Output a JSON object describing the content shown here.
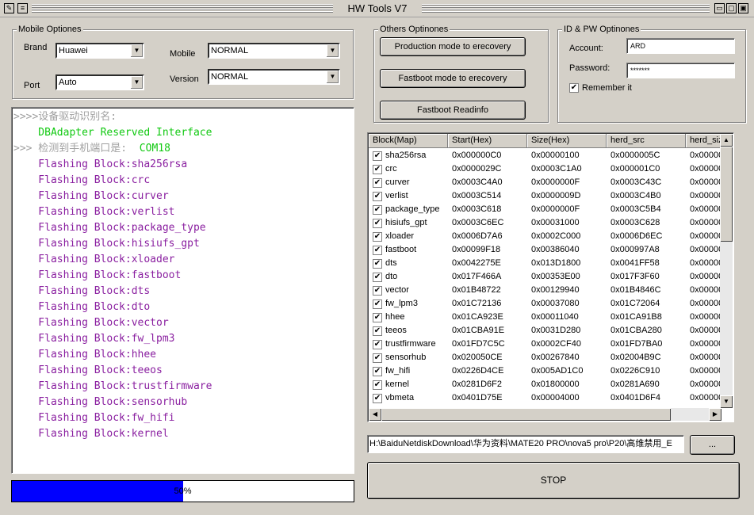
{
  "window": {
    "title": "HW Tools V7",
    "sys_icon": "app-icon",
    "buttons": [
      "minimize",
      "maximize",
      "close"
    ]
  },
  "mobile_options": {
    "label": "Mobile Optiones",
    "brand_label": "Brand",
    "brand_value": "Huawei",
    "port_label": "Port",
    "port_value": "Auto",
    "mobile_label": "Mobile",
    "mobile_value": "NORMAL",
    "version_label": "Version",
    "version_value": "NORMAL"
  },
  "other_options": {
    "label": "Others Optinones",
    "btn1": "Production mode to erecovery",
    "btn2": "Fastboot mode to erecovery",
    "btn3": "Fastboot Readinfo"
  },
  "id_pw": {
    "label": "ID & PW Optinones",
    "account_label": "Account:",
    "account_value": "ARD",
    "password_label": "Password:",
    "password_value": "*******",
    "remember_label": "Remember it",
    "remember_checked": true
  },
  "log_lines": [
    {
      "text": ">>>>设备驱动识别名:",
      "color": "gray"
    },
    {
      "text": "    DBAdapter Reserved Interface",
      "color": "green"
    },
    {
      "text": ">>> 检测到手机端口是:  COM18",
      "color": "gray",
      "suffix": "COM18"
    },
    {
      "text": "    Flashing Block:sha256rsa",
      "color": "purple"
    },
    {
      "text": "    Flashing Block:crc",
      "color": "purple"
    },
    {
      "text": "    Flashing Block:curver",
      "color": "purple"
    },
    {
      "text": "    Flashing Block:verlist",
      "color": "purple"
    },
    {
      "text": "    Flashing Block:package_type",
      "color": "purple"
    },
    {
      "text": "    Flashing Block:hisiufs_gpt",
      "color": "purple"
    },
    {
      "text": "    Flashing Block:xloader",
      "color": "purple"
    },
    {
      "text": "    Flashing Block:fastboot",
      "color": "purple"
    },
    {
      "text": "    Flashing Block:dts",
      "color": "purple"
    },
    {
      "text": "    Flashing Block:dto",
      "color": "purple"
    },
    {
      "text": "    Flashing Block:vector",
      "color": "purple"
    },
    {
      "text": "    Flashing Block:fw_lpm3",
      "color": "purple"
    },
    {
      "text": "    Flashing Block:hhee",
      "color": "purple"
    },
    {
      "text": "    Flashing Block:teeos",
      "color": "purple"
    },
    {
      "text": "    Flashing Block:trustfirmware",
      "color": "purple"
    },
    {
      "text": "    Flashing Block:sensorhub",
      "color": "purple"
    },
    {
      "text": "    Flashing Block:fw_hifi",
      "color": "purple"
    },
    {
      "text": "    Flashing Block:kernel",
      "color": "purple"
    }
  ],
  "progress": {
    "percent": 50,
    "label": "50%",
    "color": "#0000ff"
  },
  "table": {
    "headers": [
      "Block(Map)",
      "Start(Hex)",
      "Size(Hex)",
      "herd_src",
      "herd_size"
    ],
    "rows": [
      [
        "sha256rsa",
        "0x000000C0",
        "0x00000100",
        "0x0000005C",
        "0x00000"
      ],
      [
        "crc",
        "0x0000029C",
        "0x0003C1A0",
        "0x000001C0",
        "0x00000"
      ],
      [
        "curver",
        "0x0003C4A0",
        "0x0000000F",
        "0x0003C43C",
        "0x00000"
      ],
      [
        "verlist",
        "0x0003C514",
        "0x0000009D",
        "0x0003C4B0",
        "0x00000"
      ],
      [
        "package_type",
        "0x0003C618",
        "0x0000000F",
        "0x0003C5B4",
        "0x00000"
      ],
      [
        "hisiufs_gpt",
        "0x0003C6EC",
        "0x00031000",
        "0x0003C628",
        "0x00000"
      ],
      [
        "xloader",
        "0x0006D7A6",
        "0x0002C000",
        "0x0006D6EC",
        "0x00000"
      ],
      [
        "fastboot",
        "0x00099F18",
        "0x00386040",
        "0x000997A8",
        "0x00000"
      ],
      [
        "dts",
        "0x0042275E",
        "0x013D1800",
        "0x0041FF58",
        "0x00000"
      ],
      [
        "dto",
        "0x017F466A",
        "0x00353E00",
        "0x017F3F60",
        "0x00000"
      ],
      [
        "vector",
        "0x01B48722",
        "0x00129940",
        "0x01B4846C",
        "0x00000"
      ],
      [
        "fw_lpm3",
        "0x01C72136",
        "0x00037080",
        "0x01C72064",
        "0x00000"
      ],
      [
        "hhee",
        "0x01CA923E",
        "0x00011040",
        "0x01CA91B8",
        "0x00000"
      ],
      [
        "teeos",
        "0x01CBA91E",
        "0x0031D280",
        "0x01CBA280",
        "0x00000"
      ],
      [
        "trustfirmware",
        "0x01FD7C5C",
        "0x0002CF40",
        "0x01FD7BA0",
        "0x00000"
      ],
      [
        "sensorhub",
        "0x020050CE",
        "0x00267840",
        "0x02004B9C",
        "0x00000"
      ],
      [
        "fw_hifi",
        "0x0226D4CE",
        "0x005AD1C0",
        "0x0226C910",
        "0x00000"
      ],
      [
        "kernel",
        "0x0281D6F2",
        "0x01800000",
        "0x0281A690",
        "0x00000"
      ],
      [
        "vbmeta",
        "0x0401D75E",
        "0x00004000",
        "0x0401D6F4",
        "0x00000"
      ]
    ]
  },
  "path": {
    "value": "H:\\BaiduNetdiskDownload\\华为资料\\MATE20 PRO\\nova5 pro\\P20\\高维禁用_E",
    "browse_label": "..."
  },
  "stop_label": "STOP"
}
